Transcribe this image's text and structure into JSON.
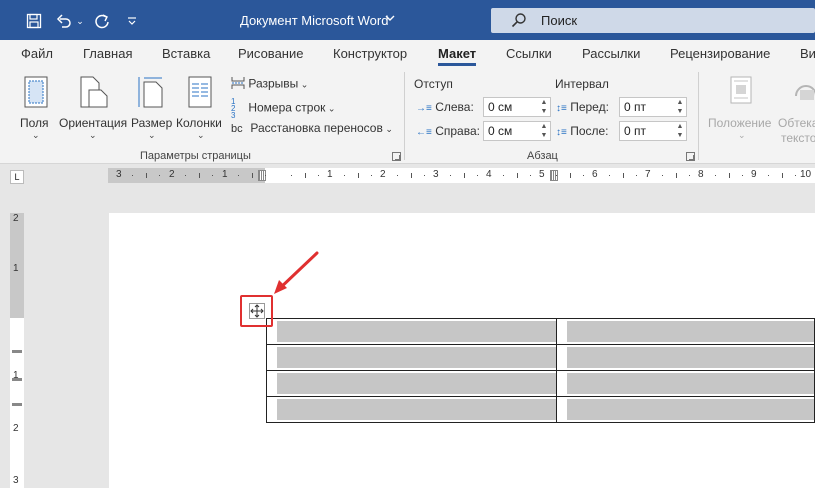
{
  "titlebar": {
    "doc_title": "Документ Microsoft Word",
    "search_placeholder": "Поиск",
    "color": "#2b579a"
  },
  "tabs": [
    "Файл",
    "Главная",
    "Вставка",
    "Рисование",
    "Конструктор",
    "Макет",
    "Ссылки",
    "Рассылки",
    "Рецензирование",
    "Ви"
  ],
  "active_tab": "Макет",
  "ribbon": {
    "page_setup": {
      "buttons": [
        "Поля",
        "Ориентация",
        "Размер",
        "Колонки"
      ],
      "small": [
        "Разрывы",
        "Номера строк",
        "Расстановка переносов"
      ],
      "small_prefix": "bc",
      "label": "Параметры страницы"
    },
    "paragraph": {
      "indent_title": "Отступ",
      "spacing_title": "Интервал",
      "left_label": "Слева:",
      "left_value": "0 см",
      "right_label": "Справа:",
      "right_value": "0 см",
      "before_label": "Перед:",
      "before_value": "0 пт",
      "after_label": "После:",
      "after_value": "0 пт",
      "label": "Абзац"
    },
    "arrange": {
      "position": "Положение",
      "wrap": "Обтека",
      "wrap2": "тексто"
    }
  },
  "hruler": {
    "left_numbers": [
      "3",
      "2",
      "1"
    ],
    "right_numbers": [
      "1",
      "2",
      "3",
      "4",
      "5",
      "6",
      "7",
      "8",
      "9",
      "10"
    ]
  },
  "corner_symbol": "L",
  "vruler_numbers": [
    "2",
    "1",
    "1",
    "2",
    "3"
  ],
  "table": {
    "rows": [
      [
        "",
        ""
      ],
      [
        "",
        ""
      ],
      [
        "",
        ""
      ],
      [
        "",
        ""
      ]
    ]
  },
  "highlight_color": "#e03030"
}
